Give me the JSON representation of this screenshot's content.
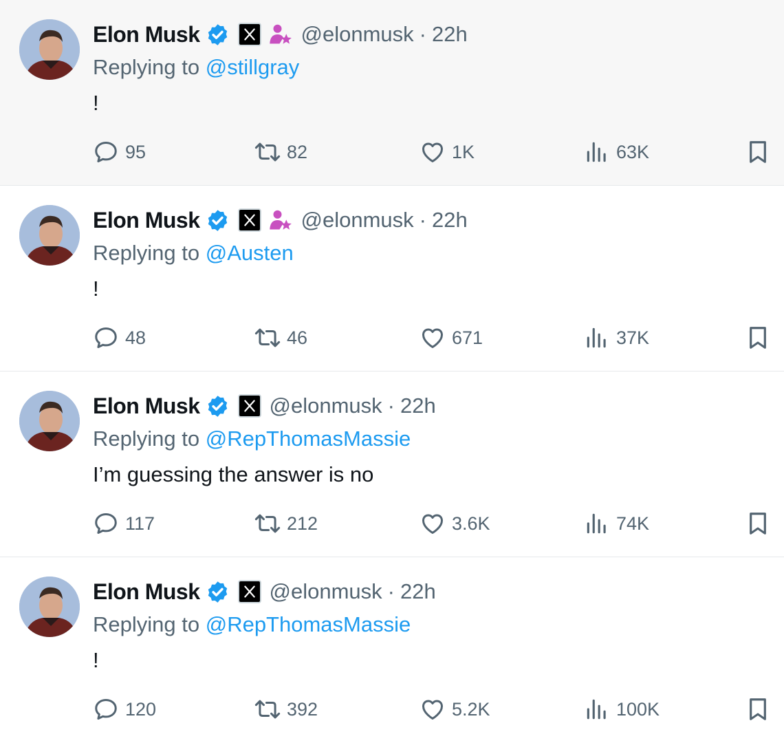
{
  "tweets": [
    {
      "author": {
        "name": "Elon Musk",
        "handle": "@elonmusk"
      },
      "time": "22h",
      "replying_prefix": "Replying to ",
      "replying_to": "@stillgray",
      "text": "!",
      "has_affiliate_badge": true,
      "stats": {
        "replies": "95",
        "reposts": "82",
        "likes": "1K",
        "views": "63K"
      }
    },
    {
      "author": {
        "name": "Elon Musk",
        "handle": "@elonmusk"
      },
      "time": "22h",
      "replying_prefix": "Replying to ",
      "replying_to": "@Austen",
      "text": "!",
      "has_affiliate_badge": true,
      "stats": {
        "replies": "48",
        "reposts": "46",
        "likes": "671",
        "views": "37K"
      }
    },
    {
      "author": {
        "name": "Elon Musk",
        "handle": "@elonmusk"
      },
      "time": "22h",
      "replying_prefix": "Replying to ",
      "replying_to": "@RepThomasMassie",
      "text": "I’m guessing the answer is no",
      "has_affiliate_badge": false,
      "stats": {
        "replies": "117",
        "reposts": "212",
        "likes": "3.6K",
        "views": "74K"
      }
    },
    {
      "author": {
        "name": "Elon Musk",
        "handle": "@elonmusk"
      },
      "time": "22h",
      "replying_prefix": "Replying to ",
      "replying_to": "@RepThomasMassie",
      "text": "!",
      "has_affiliate_badge": false,
      "stats": {
        "replies": "120",
        "reposts": "392",
        "likes": "5.2K",
        "views": "100K"
      }
    }
  ],
  "colors": {
    "accent": "#1d9bf0",
    "secondary_text": "#536471",
    "affiliate": "#c850c0",
    "first_row_bg": "#f7f7f7"
  },
  "icons": [
    "verified-badge-icon",
    "x-logo-icon",
    "affiliate-icon",
    "reply-icon",
    "repost-icon",
    "like-icon",
    "views-icon",
    "bookmark-icon"
  ]
}
